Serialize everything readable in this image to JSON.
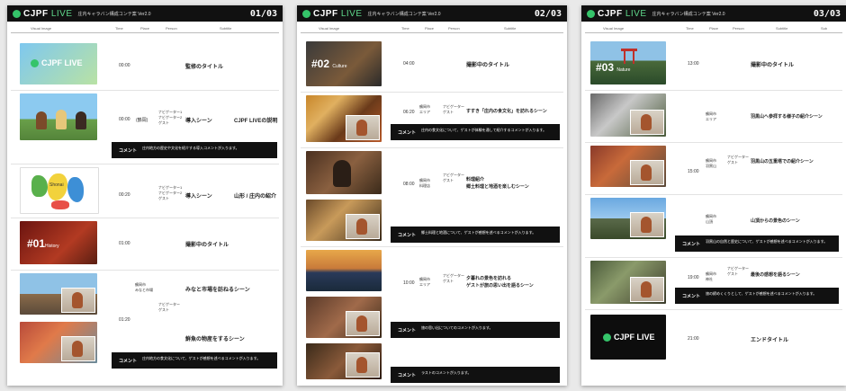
{
  "header": {
    "logo_main": "CJPF",
    "logo_live": "LIVE",
    "subtitle": "庄内キャラバン構成コンテ案 Ver2.0",
    "pages": [
      "01/03",
      "02/03",
      "03/03"
    ]
  },
  "columns": {
    "visual": "Visual Image",
    "time": "Time",
    "place": "Place",
    "person": "Person",
    "subtitle": "Subtitle",
    "sub": "Sub"
  },
  "page1": {
    "rows": [
      {
        "time": "00:00",
        "place": "",
        "person": "",
        "desc": "監修のタイトル"
      },
      {
        "time": "00:00",
        "place": "(鶴岡)",
        "person": "ナビゲーター1\nナビゲーター2\nゲスト",
        "desc": "導入シーン",
        "desc2": "CJPF LIVEの説明"
      },
      {
        "time": "00:20",
        "place": "",
        "person": "ナビゲーター1\nナビゲーター2\nゲスト",
        "desc": "導入シーン",
        "desc2": "山形 / 庄内の紹介"
      },
      {
        "time": "01:00",
        "place": "",
        "person": "",
        "desc": "撮影中のタイトル"
      },
      {
        "time": "01:20",
        "place": "鶴岡市\nみなと市場",
        "person": "ナビゲーター\nゲスト",
        "desc": "みなと市場を訪ねるシーン",
        "desc2": "鮮魚の物産をするシーン"
      }
    ],
    "title_overlay": "#01",
    "title_overlay_small": "History",
    "map_label": "Shonai",
    "comments": [
      {
        "label": "コメント",
        "text": "庄内地方の歴史や文化を紹介する導入コメントが入ります。"
      },
      {
        "label": "コメント",
        "text": "庄内地方の食文化について、ゲストが感想を述べるコメントが入ります。"
      }
    ]
  },
  "page2": {
    "title_overlay": "#02",
    "title_overlay_small": "Culture",
    "rows": [
      {
        "time": "04:00",
        "desc": "撮影中のタイトル"
      },
      {
        "time": "06:20",
        "place": "鶴岡市\nエリア",
        "person": "ナビゲーター\nゲスト",
        "desc": "すすき「庄内の食文化」を訪れるシーン"
      },
      {
        "time": "08:00",
        "place": "鶴岡市\n料理店",
        "person": "ナビゲーター\nゲスト",
        "desc": "料理紹介",
        "desc2": "郷土料理と地酒を楽しむシーン"
      },
      {
        "time": "10:00",
        "place": "鶴岡市\nエリア",
        "person": "ナビゲーター\nゲスト",
        "desc": "夕暮れの景色を訪れる",
        "desc2": "ゲストが旅の思い出を語るシーン"
      }
    ],
    "comments": [
      {
        "label": "コメント",
        "text": "庄内の食文化について、ゲストが体験を通して紹介するコメントが入ります。"
      },
      {
        "label": "コメント",
        "text": "郷土料理と地酒について、ゲストが感想を述べるコメントが入ります。"
      },
      {
        "label": "コメント",
        "text": "旅の思い出についてのコメントが入ります。"
      },
      {
        "label": "コメント",
        "text": "ラストのコメントが入ります。"
      }
    ]
  },
  "page3": {
    "title_overlay": "#03",
    "title_overlay_small": "Nature",
    "rows": [
      {
        "time": "13:00",
        "desc": "撮影中のタイトル"
      },
      {
        "time": "",
        "place": "鶴岡市\nエリア",
        "person": "",
        "desc": "羽黒山へ参拝する様子の紹介シーン"
      },
      {
        "time": "15:00",
        "place": "鶴岡市\n羽黒山",
        "person": "ナビゲーター\nゲスト",
        "desc": "羽黒山の五重塔での紹介シーン"
      },
      {
        "time": "",
        "place": "鶴岡市\n山頂",
        "person": "",
        "desc": "山頂からの景色のシーン"
      },
      {
        "time": "19:00",
        "place": "鶴岡市\n神社",
        "person": "ナビゲーター\nゲスト",
        "desc": "最後の感想を語るシーン"
      },
      {
        "time": "21:00",
        "desc": "エンドタイトル"
      }
    ],
    "comments": [
      {
        "label": "コメント",
        "text": "羽黒山の自然と歴史について、ゲストが感想を述べるコメントが入ります。"
      },
      {
        "label": "コメント",
        "text": "旅の締めくくりとして、ゲストが感想を述べるコメントが入ります。"
      }
    ]
  },
  "colors": {
    "accent": "#35c46a",
    "dark": "#111111"
  }
}
